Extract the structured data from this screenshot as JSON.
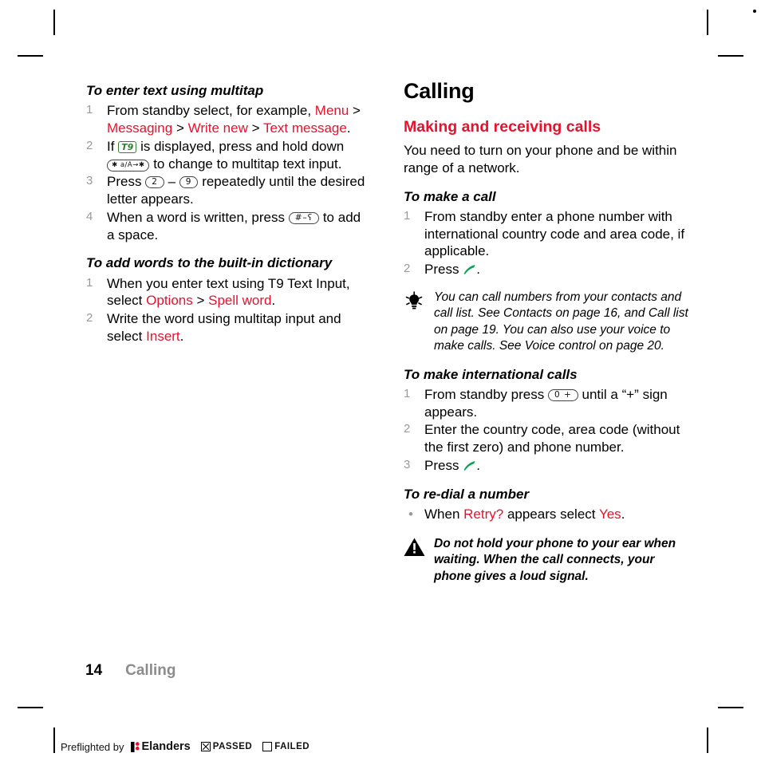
{
  "page": {
    "folio_number": "14",
    "folio_chapter": "Calling"
  },
  "left_column": {
    "task1": {
      "heading": "To enter text using multitap",
      "steps": [
        {
          "num": "1",
          "parts": [
            {
              "t": "From standby select, for example, ",
              "s": "plain"
            },
            {
              "t": "Menu",
              "s": "red"
            },
            {
              "t": " > ",
              "s": "plain"
            },
            {
              "t": "Messaging",
              "s": "red"
            },
            {
              "t": " > ",
              "s": "plain"
            },
            {
              "t": "Write new",
              "s": "red"
            },
            {
              "t": " > ",
              "s": "plain"
            },
            {
              "t": "Text message",
              "s": "red"
            },
            {
              "t": ".",
              "s": "plain"
            }
          ]
        },
        {
          "num": "2",
          "parts": [
            {
              "t": "If ",
              "s": "plain"
            },
            {
              "t": "T9",
              "s": "t9-icon"
            },
            {
              "t": " is displayed, press and hold down ",
              "s": "plain"
            },
            {
              "t": "✱ a/A→✱",
              "s": "key-small"
            },
            {
              "t": " to change to multitap text input.",
              "s": "plain"
            }
          ]
        },
        {
          "num": "3",
          "parts": [
            {
              "t": "Press ",
              "s": "plain"
            },
            {
              "t": "2",
              "s": "key"
            },
            {
              "t": " – ",
              "s": "plain"
            },
            {
              "t": "9",
              "s": "key"
            },
            {
              "t": " repeatedly until the desired letter appears.",
              "s": "plain"
            }
          ]
        },
        {
          "num": "4",
          "parts": [
            {
              "t": "When a word is written, press ",
              "s": "plain"
            },
            {
              "t": "#–ʕ",
              "s": "key"
            },
            {
              "t": " to add a space.",
              "s": "plain"
            }
          ]
        }
      ]
    },
    "task2": {
      "heading": "To add words to the built-in dictionary",
      "steps": [
        {
          "num": "1",
          "parts": [
            {
              "t": "When you enter text using T9 Text Input, select ",
              "s": "plain"
            },
            {
              "t": "Options",
              "s": "red"
            },
            {
              "t": " > ",
              "s": "plain"
            },
            {
              "t": "Spell word",
              "s": "red"
            },
            {
              "t": ".",
              "s": "plain"
            }
          ]
        },
        {
          "num": "2",
          "parts": [
            {
              "t": "Write the word using multitap input and select ",
              "s": "plain"
            },
            {
              "t": "Insert",
              "s": "red"
            },
            {
              "t": ".",
              "s": "plain"
            }
          ]
        }
      ]
    }
  },
  "right_column": {
    "chapter_title": "Calling",
    "section_title": "Making and receiving calls",
    "intro": "You need to turn on your phone and be within range of a network.",
    "task_make_call": {
      "heading": "To make a call",
      "steps": [
        {
          "num": "1",
          "parts": [
            {
              "t": "From standby enter a phone number with international country code and area code, if applicable.",
              "s": "plain"
            }
          ]
        },
        {
          "num": "2",
          "parts": [
            {
              "t": "Press ",
              "s": "plain"
            },
            {
              "t": "call",
              "s": "call-icon"
            },
            {
              "t": ".",
              "s": "plain"
            }
          ]
        }
      ]
    },
    "tip_note": "You can call numbers from your contacts and call list. See Contacts on page 16, and Call list on page 19. You can also use your voice to make calls. See Voice control on page 20.",
    "task_international": {
      "heading": "To make international calls",
      "steps": [
        {
          "num": "1",
          "parts": [
            {
              "t": "From standby press ",
              "s": "plain"
            },
            {
              "t": "0 +",
              "s": "key"
            },
            {
              "t": " until a “+” sign appears.",
              "s": "plain"
            }
          ]
        },
        {
          "num": "2",
          "parts": [
            {
              "t": "Enter the country code, area code (without the first zero) and phone number.",
              "s": "plain"
            }
          ]
        },
        {
          "num": "3",
          "parts": [
            {
              "t": "Press ",
              "s": "plain"
            },
            {
              "t": "call",
              "s": "call-icon"
            },
            {
              "t": ".",
              "s": "plain"
            }
          ]
        }
      ]
    },
    "task_redial": {
      "heading": "To re-dial a number",
      "steps": [
        {
          "bullet": "•",
          "parts": [
            {
              "t": "When ",
              "s": "plain"
            },
            {
              "t": "Retry?",
              "s": "red"
            },
            {
              "t": " appears select ",
              "s": "plain"
            },
            {
              "t": "Yes",
              "s": "red"
            },
            {
              "t": ".",
              "s": "plain"
            }
          ]
        }
      ]
    },
    "warning_note": "Do not hold your phone to your ear when waiting. When the call connects, your phone gives a loud signal."
  },
  "footer": {
    "preflight_label": "Preflighted by",
    "brand": "Elanders",
    "passed_label": "PASSED",
    "failed_label": "FAILED"
  },
  "colors": {
    "accent_red": "#e8112d",
    "step_number_gray": "#9a9a9a",
    "call_green": "#00a651"
  }
}
